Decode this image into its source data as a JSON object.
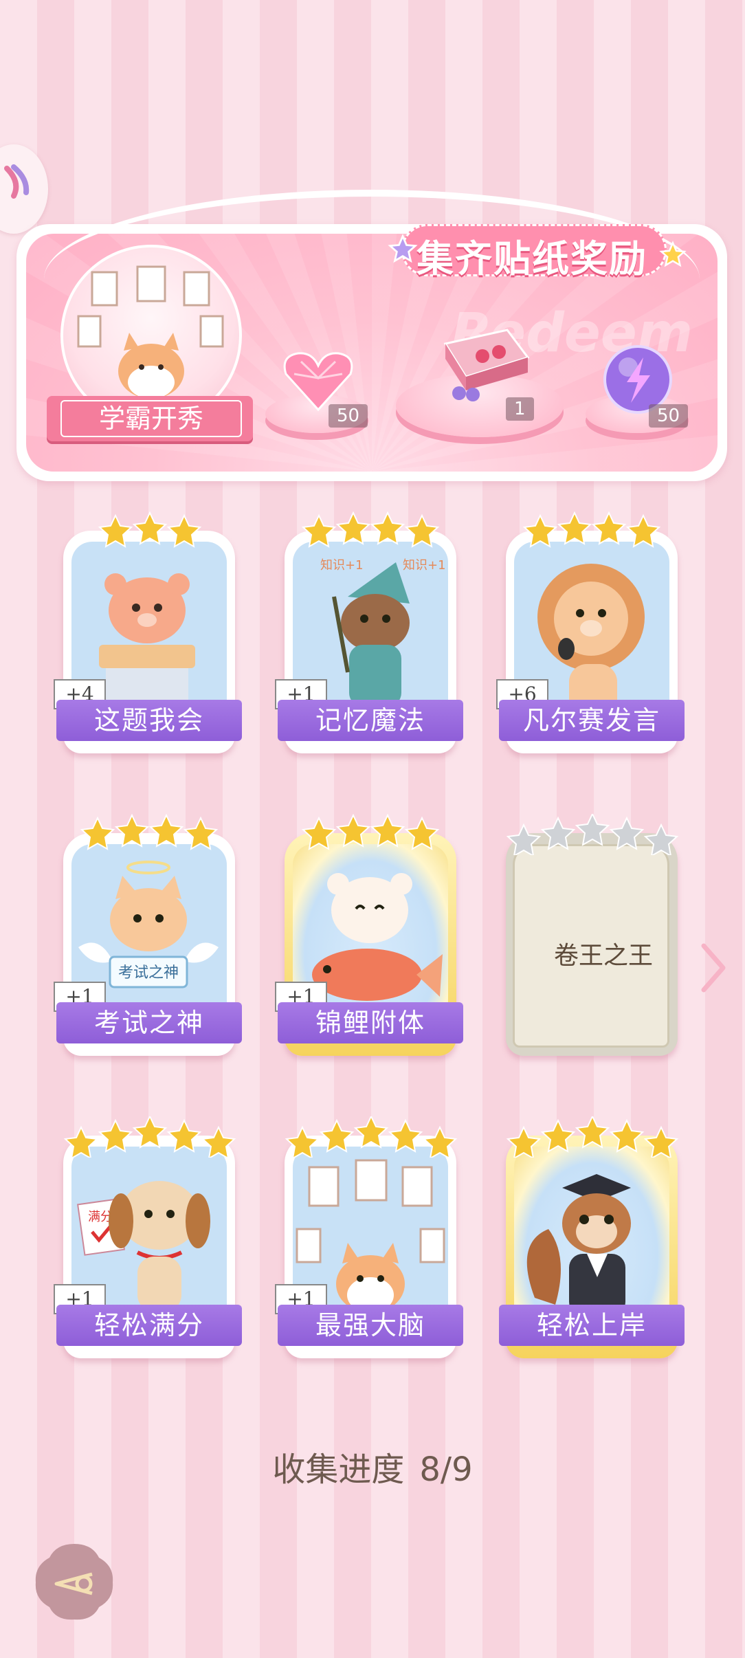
{
  "banner": {
    "title": "集齐贴纸奖励",
    "watermark": "Redeem",
    "badge_label": "学霸开秀",
    "rewards": [
      {
        "icon": "pink-diamond-heart-icon",
        "qty": "50"
      },
      {
        "icon": "gift-box-icon",
        "qty": "1"
      },
      {
        "icon": "lightning-orb-icon",
        "qty": "50"
      }
    ]
  },
  "stickers": [
    {
      "name": "这题我会",
      "count": "+4",
      "stars": 3,
      "frame": "normal"
    },
    {
      "name": "记忆魔法",
      "count": "+1",
      "stars": 4,
      "frame": "normal"
    },
    {
      "name": "凡尔赛发言",
      "count": "+6",
      "stars": 4,
      "frame": "normal"
    },
    {
      "name": "考试之神",
      "count": "+1",
      "stars": 4,
      "frame": "normal"
    },
    {
      "name": "锦鲤附体",
      "count": "+1",
      "stars": 4,
      "frame": "gold"
    },
    {
      "name": "卷王之王",
      "count": "",
      "stars": 5,
      "frame": "locked"
    },
    {
      "name": "轻松满分",
      "count": "+1",
      "stars": 5,
      "frame": "normal"
    },
    {
      "name": "最强大脑",
      "count": "+1",
      "stars": 5,
      "frame": "normal"
    },
    {
      "name": "轻松上岸",
      "count": "",
      "stars": 5,
      "frame": "gold"
    }
  ],
  "card_texts": {
    "exam_god_sign": "考试之神",
    "full_score_sign": "满分",
    "magic_sign": "知识+1"
  },
  "progress": {
    "label": "收集进度",
    "value": "8/9"
  },
  "colors": {
    "accent": "#f47d9c",
    "label_purple": "#9a6ae0",
    "star_gold": "#f5c431",
    "bg_pink": "#fbe3ea"
  }
}
